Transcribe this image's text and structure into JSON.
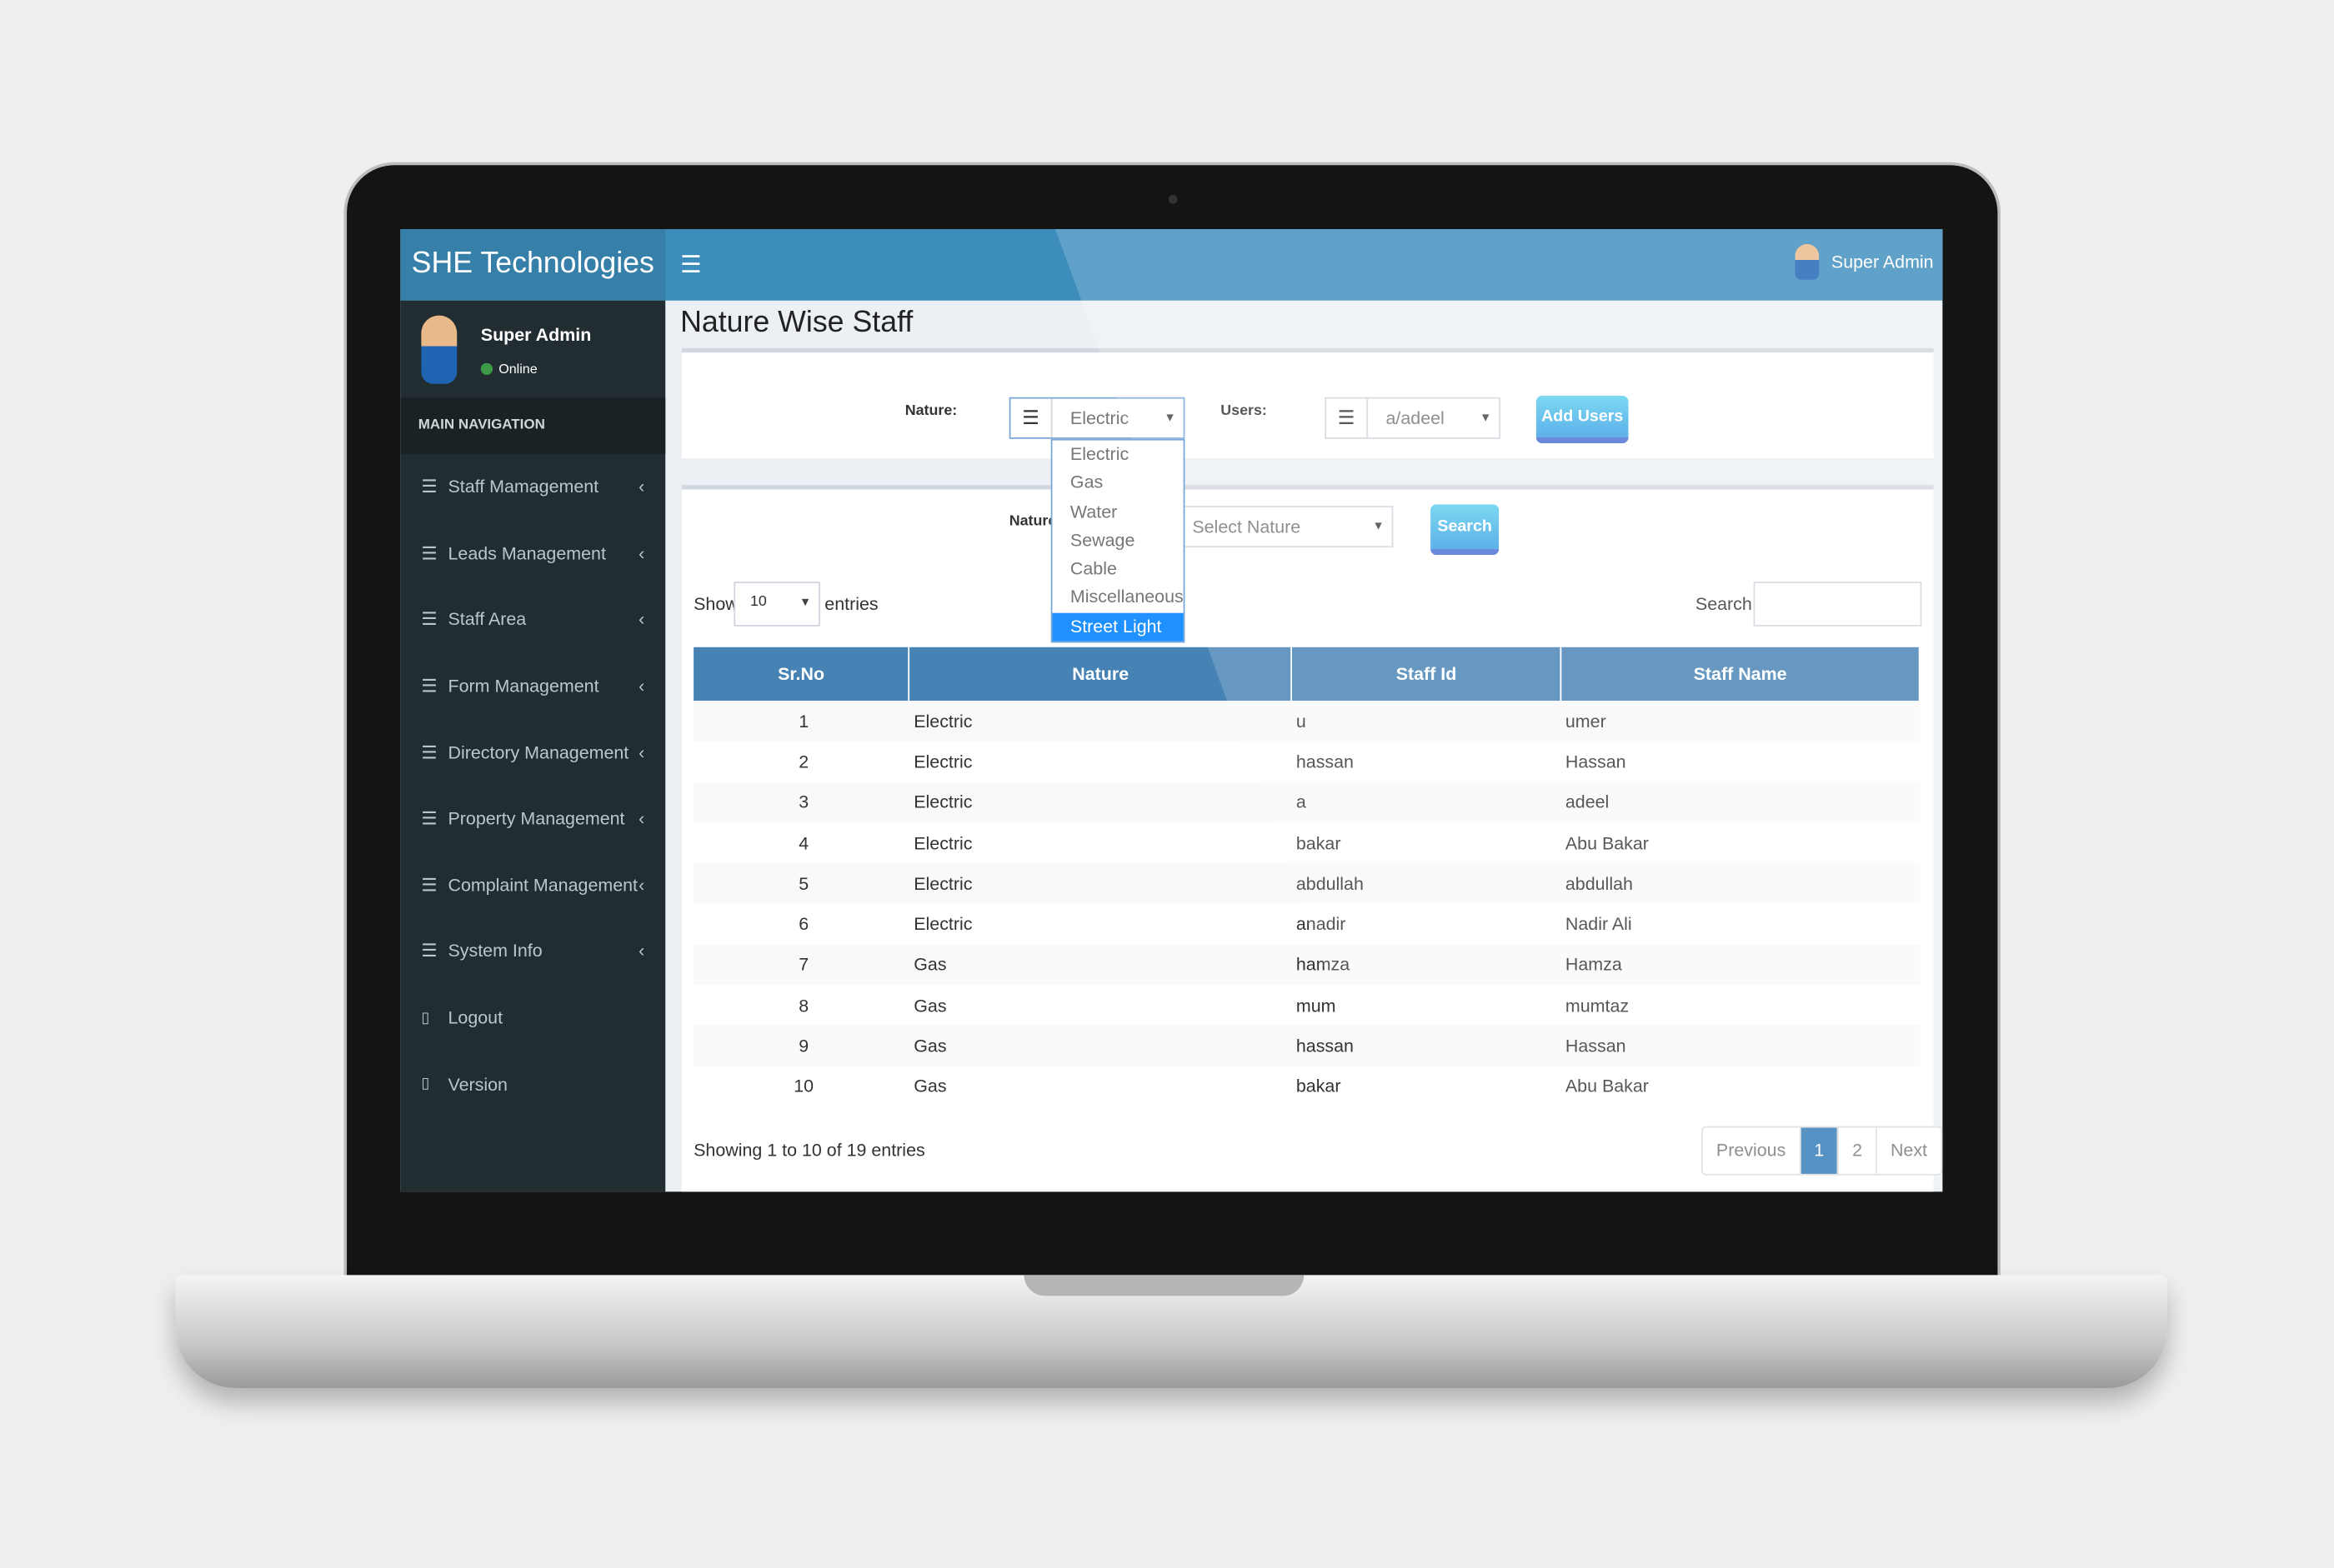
{
  "header": {
    "brand": "SHE Technologies",
    "user": "Super Admin"
  },
  "sidebar": {
    "user": "Super Admin",
    "status": "Online",
    "section": "MAIN NAVIGATION",
    "items": [
      {
        "label": "Staff Mamagement"
      },
      {
        "label": "Leads Management"
      },
      {
        "label": "Staff Area"
      },
      {
        "label": "Form Management"
      },
      {
        "label": "Directory Management"
      },
      {
        "label": "Property Management"
      },
      {
        "label": "Complaint Management"
      },
      {
        "label": "System Info"
      }
    ],
    "extra": [
      {
        "label": "Logout"
      },
      {
        "label": "Version"
      }
    ]
  },
  "page": {
    "title": "Nature Wise Staff"
  },
  "form": {
    "nature_label": "Nature:",
    "nature_value": "Electric",
    "users_label": "Users:",
    "users_value": "a/adeel",
    "add_button": "Add Users",
    "nature_options": [
      "Electric",
      "Gas",
      "Water",
      "Sewage",
      "Cable",
      "Miscellaneous",
      "Street Light"
    ],
    "highlighted_option": "Street Light"
  },
  "filter": {
    "nature_label": "Nature",
    "placeholder": "Select Nature",
    "search_button": "Search"
  },
  "table_controls": {
    "show": "Show",
    "entries_value": "10",
    "entries": "entries",
    "search_label": "Search:"
  },
  "table": {
    "columns": [
      "Sr.No",
      "Nature",
      "Staff Id",
      "Staff Name"
    ],
    "rows": [
      [
        "1",
        "Electric",
        "u",
        "umer"
      ],
      [
        "2",
        "Electric",
        "hassan",
        "Hassan"
      ],
      [
        "3",
        "Electric",
        "a",
        "adeel"
      ],
      [
        "4",
        "Electric",
        "bakar",
        "Abu Bakar"
      ],
      [
        "5",
        "Electric",
        "abdullah",
        "abdullah"
      ],
      [
        "6",
        "Electric",
        "anadir",
        "Nadir Ali"
      ],
      [
        "7",
        "Gas",
        "hamza",
        "Hamza"
      ],
      [
        "8",
        "Gas",
        "mum",
        "mumtaz"
      ],
      [
        "9",
        "Gas",
        "hassan",
        "Hassan"
      ],
      [
        "10",
        "Gas",
        "bakar",
        "Abu Bakar"
      ]
    ]
  },
  "footer": {
    "info": "Showing 1 to 10 of 19 entries",
    "previous": "Previous",
    "pages": [
      "1",
      "2"
    ],
    "current_page": "1",
    "next": "Next"
  },
  "colors": {
    "header": "#3c8dbc",
    "logo": "#367fa9",
    "sidebar": "#222d32",
    "table_header": "#4682b4",
    "highlight": "#1e90ff"
  }
}
